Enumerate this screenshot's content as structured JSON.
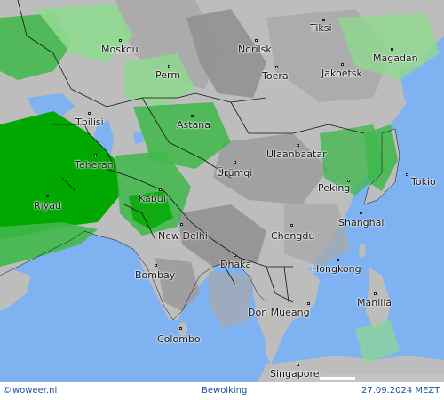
{
  "map": {
    "title": "Bewolking",
    "source": "woweer.nl",
    "copyright_symbol": "©",
    "datetime": "27.09.2024 MEZT",
    "colors": {
      "sea": "#7fb2f0",
      "land": "#bdbdbd",
      "cloud_light": "#a8a8a8",
      "cloud_dark": "#8a8a8a",
      "green_light": "#8fd88f",
      "green_mid": "#3fb84a",
      "green_dark": "#00a800",
      "border": "#111111"
    },
    "cities": [
      {
        "id": "tiksi",
        "name": "Tiksi"
      },
      {
        "id": "moskou",
        "name": "Moskou"
      },
      {
        "id": "norilsk",
        "name": "Norilsk"
      },
      {
        "id": "magadan",
        "name": "Magadan"
      },
      {
        "id": "perm",
        "name": "Perm"
      },
      {
        "id": "toera",
        "name": "Toera"
      },
      {
        "id": "jakoetsk",
        "name": "Jakoetsk"
      },
      {
        "id": "tbilisi",
        "name": "Tbilisi"
      },
      {
        "id": "astana",
        "name": "Astana"
      },
      {
        "id": "ulaanbaatar",
        "name": "Ulaanbaatar"
      },
      {
        "id": "teheran",
        "name": "Teheran"
      },
      {
        "id": "urumqi",
        "name": "Ürümqi"
      },
      {
        "id": "tokio",
        "name": "Tokio"
      },
      {
        "id": "peking",
        "name": "Peking"
      },
      {
        "id": "riyad",
        "name": "Riyad"
      },
      {
        "id": "kabul",
        "name": "Kabul"
      },
      {
        "id": "shanghai",
        "name": "Shanghai"
      },
      {
        "id": "newdelhi",
        "name": "New Delhi"
      },
      {
        "id": "chengdu",
        "name": "Chengdu"
      },
      {
        "id": "dhaka",
        "name": "Dhaka"
      },
      {
        "id": "hongkong",
        "name": "Hongkong"
      },
      {
        "id": "bombay",
        "name": "Bombay"
      },
      {
        "id": "manilla",
        "name": "Manilla"
      },
      {
        "id": "donmueang",
        "name": "Don Mueang"
      },
      {
        "id": "colombo",
        "name": "Colombo"
      },
      {
        "id": "singapore",
        "name": "Singapore"
      }
    ]
  }
}
